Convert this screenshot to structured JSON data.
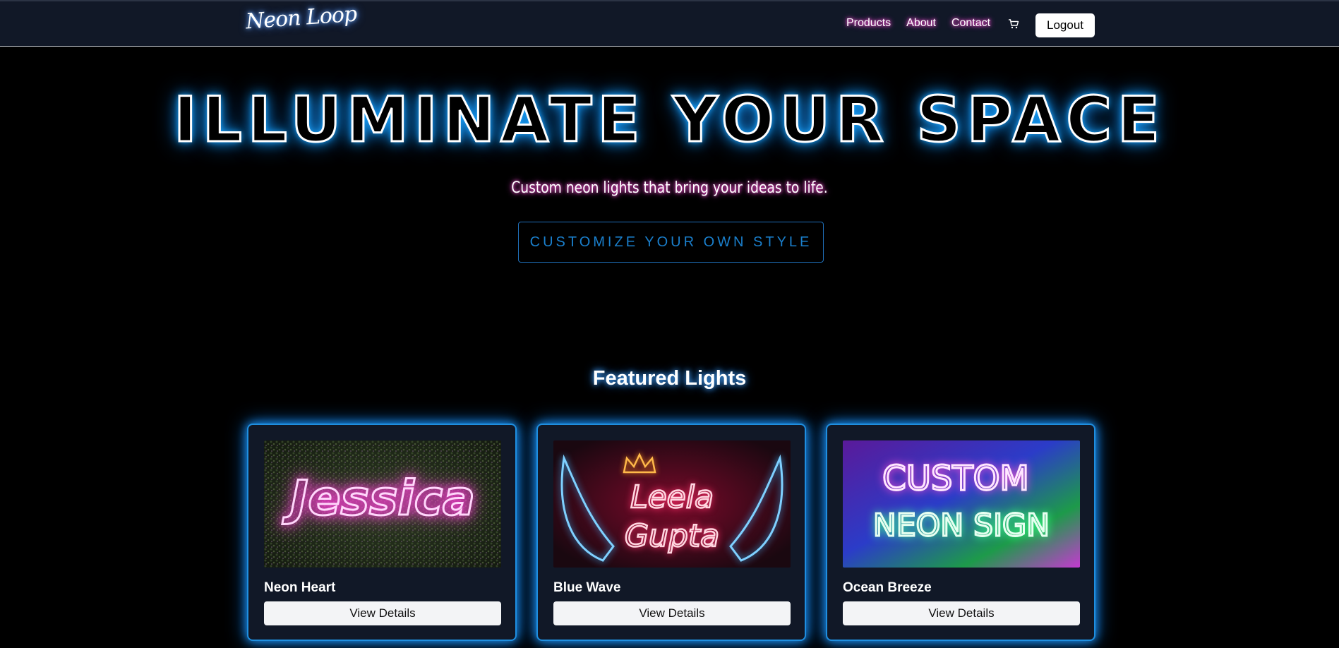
{
  "nav": {
    "logo": "Neon Loop",
    "links": [
      "Products",
      "About",
      "Contact"
    ],
    "cart_icon": "cart-icon",
    "logout_label": "Logout"
  },
  "hero": {
    "title": "ILLUMINATE YOUR SPACE",
    "subtitle": "Custom neon lights that bring your ideas to life.",
    "cta_label": "CUSTOMIZE YOUR OWN STYLE"
  },
  "featured": {
    "title": "Featured Lights",
    "cards": [
      {
        "name": "Neon Heart",
        "button_label": "View Details",
        "image_text": "Jessica"
      },
      {
        "name": "Blue Wave",
        "button_label": "View Details",
        "image_text_line1": "Leela",
        "image_text_line2": "Gupta"
      },
      {
        "name": "Ocean Breeze",
        "button_label": "View Details",
        "image_text_line1": "CUSTOM",
        "image_text_line2": "NEON SIGN"
      }
    ]
  },
  "colors": {
    "navbar_bg": "#111827",
    "neon_blue": "#19a4ff",
    "neon_pink": "#ff4fd8",
    "card_bg": "#111827"
  }
}
